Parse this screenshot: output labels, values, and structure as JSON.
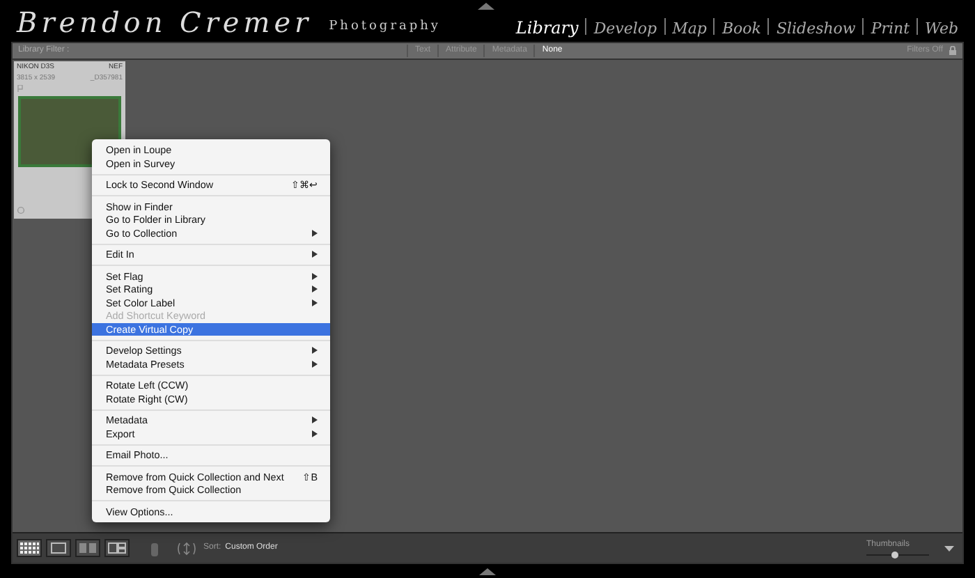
{
  "header": {
    "logo": "Brendon Cremer",
    "tagline": "Photography",
    "modules": [
      {
        "label": "Library",
        "selected": true
      },
      {
        "label": "Develop",
        "selected": false
      },
      {
        "label": "Map",
        "selected": false
      },
      {
        "label": "Book",
        "selected": false
      },
      {
        "label": "Slideshow",
        "selected": false
      },
      {
        "label": "Print",
        "selected": false
      },
      {
        "label": "Web",
        "selected": false
      }
    ]
  },
  "filter_bar": {
    "title": "Library Filter :",
    "tabs": [
      {
        "label": "Text",
        "selected": false
      },
      {
        "label": "Attribute",
        "selected": false
      },
      {
        "label": "Metadata",
        "selected": false
      },
      {
        "label": "None",
        "selected": true
      }
    ],
    "status": "Filters Off"
  },
  "thumbnail": {
    "camera": "NIKON D3S",
    "format": "NEF",
    "dimensions": "3815 x 2539",
    "filename": "_D357981",
    "selected": true
  },
  "context_menu": {
    "groups": [
      [
        {
          "label": "Open in Loupe",
          "submenu": false,
          "disabled": false,
          "selected": false
        },
        {
          "label": "Open in Survey",
          "submenu": false,
          "disabled": false,
          "selected": false
        }
      ],
      [
        {
          "label": "Lock to Second Window",
          "shortcut": "⇧⌘↩",
          "submenu": false,
          "disabled": false,
          "selected": false
        }
      ],
      [
        {
          "label": "Show in Finder",
          "submenu": false,
          "disabled": false,
          "selected": false
        },
        {
          "label": "Go to Folder in Library",
          "submenu": false,
          "disabled": false,
          "selected": false
        },
        {
          "label": "Go to Collection",
          "submenu": true,
          "disabled": false,
          "selected": false
        }
      ],
      [
        {
          "label": "Edit In",
          "submenu": true,
          "disabled": false,
          "selected": false
        }
      ],
      [
        {
          "label": "Set Flag",
          "submenu": true,
          "disabled": false,
          "selected": false
        },
        {
          "label": "Set Rating",
          "submenu": true,
          "disabled": false,
          "selected": false
        },
        {
          "label": "Set Color Label",
          "submenu": true,
          "disabled": false,
          "selected": false
        },
        {
          "label": "Add Shortcut Keyword",
          "submenu": false,
          "disabled": true,
          "selected": false
        },
        {
          "label": "Create Virtual Copy",
          "submenu": false,
          "disabled": false,
          "selected": true
        }
      ],
      [
        {
          "label": "Develop Settings",
          "submenu": true,
          "disabled": false,
          "selected": false
        },
        {
          "label": "Metadata Presets",
          "submenu": true,
          "disabled": false,
          "selected": false
        }
      ],
      [
        {
          "label": "Rotate Left (CCW)",
          "submenu": false,
          "disabled": false,
          "selected": false
        },
        {
          "label": "Rotate Right (CW)",
          "submenu": false,
          "disabled": false,
          "selected": false
        }
      ],
      [
        {
          "label": "Metadata",
          "submenu": true,
          "disabled": false,
          "selected": false
        },
        {
          "label": "Export",
          "submenu": true,
          "disabled": false,
          "selected": false
        }
      ],
      [
        {
          "label": "Email Photo...",
          "submenu": false,
          "disabled": false,
          "selected": false
        }
      ],
      [
        {
          "label": "Remove from Quick Collection and Next",
          "shortcut": "⇧B",
          "submenu": false,
          "disabled": false,
          "selected": false
        },
        {
          "label": "Remove from Quick Collection",
          "submenu": false,
          "disabled": false,
          "selected": false
        }
      ],
      [
        {
          "label": "View Options...",
          "submenu": false,
          "disabled": false,
          "selected": false
        }
      ]
    ]
  },
  "toolbar": {
    "view_modes": [
      {
        "kind": "grid",
        "selected": true
      },
      {
        "kind": "loupe",
        "selected": false
      },
      {
        "kind": "compare",
        "selected": false
      },
      {
        "kind": "survey",
        "selected": false
      }
    ],
    "sort_label": "Sort:",
    "sort_value": "Custom Order",
    "thumbnails_label": "Thumbnails",
    "thumbnails": {
      "level": 0.45
    }
  }
}
